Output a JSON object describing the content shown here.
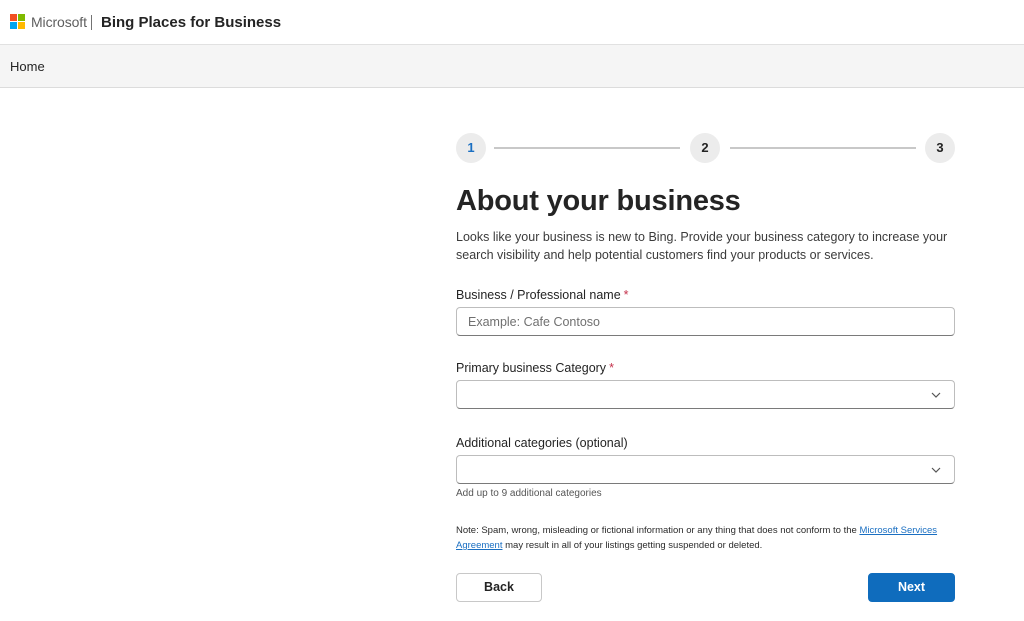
{
  "header": {
    "brand": "Microsoft",
    "product": "Bing Places for Business",
    "logo_icon": "microsoft-logo"
  },
  "nav": {
    "home": "Home"
  },
  "stepper": {
    "steps": [
      "1",
      "2",
      "3"
    ],
    "current": 1,
    "active_color": "#1a6fc2"
  },
  "form": {
    "title": "About your business",
    "intro": "Looks like your business is new to Bing. Provide your business category to increase your search visibility and help potential customers find your products or services.",
    "business_name": {
      "label": "Business / Professional name",
      "required_mark": "*",
      "value": "",
      "placeholder": "Example: Cafe Contoso"
    },
    "primary_category": {
      "label": "Primary business Category",
      "required_mark": "*",
      "value": "",
      "icon": "chevron-down-icon"
    },
    "additional_categories": {
      "label": "Additional categories (optional)",
      "value": "",
      "helper": "Add up to 9 additional categories",
      "icon": "chevron-down-icon"
    },
    "note": {
      "prefix": "Note: Spam, wrong, misleading or fictional information or any thing that does not conform to the ",
      "link": "Microsoft Services Agreement",
      "suffix": " may result in all of your listings getting suspended or deleted."
    }
  },
  "actions": {
    "back": "Back",
    "next": "Next"
  },
  "colors": {
    "primary": "#0f6cbd",
    "required": "#c4314b",
    "link": "#1a6fc2"
  }
}
